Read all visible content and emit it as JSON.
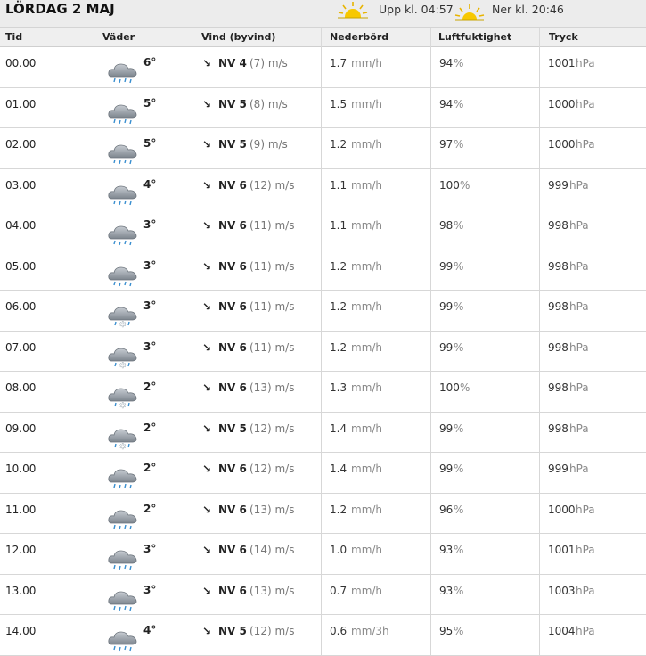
{
  "header": {
    "day": "LÖRDAG 2 MAJ",
    "sunrise_label": "Upp kl. 04:57",
    "sunset_label": "Ner kl. 20:46",
    "sun_icon_color": "#f2c400"
  },
  "columns": [
    "Tid",
    "Väder",
    "Vind (byvind)",
    "Nederbörd",
    "Luftfuktighet",
    "Tryck"
  ],
  "units": {
    "wind": "m/s",
    "pressure": "hPa",
    "humidity": "%"
  },
  "rows": [
    {
      "time": "00.00",
      "icon": "rain-cloud-icon",
      "temp": "6°",
      "arrow": "↘",
      "dir": "NV 4",
      "gust": "(7)",
      "precip": "1.7",
      "precip_unit": "mm/h",
      "humidity": "94",
      "pressure": "1001"
    },
    {
      "time": "01.00",
      "icon": "rain-cloud-icon",
      "temp": "5°",
      "arrow": "↘",
      "dir": "NV 5",
      "gust": "(8)",
      "precip": "1.5",
      "precip_unit": "mm/h",
      "humidity": "94",
      "pressure": "1000"
    },
    {
      "time": "02.00",
      "icon": "rain-cloud-icon",
      "temp": "5°",
      "arrow": "↘",
      "dir": "NV 5",
      "gust": "(9)",
      "precip": "1.2",
      "precip_unit": "mm/h",
      "humidity": "97",
      "pressure": "1000"
    },
    {
      "time": "03.00",
      "icon": "rain-cloud-icon",
      "temp": "4°",
      "arrow": "↘",
      "dir": "NV 6",
      "gust": "(12)",
      "precip": "1.1",
      "precip_unit": "mm/h",
      "humidity": "100",
      "pressure": "999"
    },
    {
      "time": "04.00",
      "icon": "rain-cloud-icon",
      "temp": "3°",
      "arrow": "↘",
      "dir": "NV 6",
      "gust": "(11)",
      "precip": "1.1",
      "precip_unit": "mm/h",
      "humidity": "98",
      "pressure": "998"
    },
    {
      "time": "05.00",
      "icon": "rain-cloud-icon",
      "temp": "3°",
      "arrow": "↘",
      "dir": "NV 6",
      "gust": "(11)",
      "precip": "1.2",
      "precip_unit": "mm/h",
      "humidity": "99",
      "pressure": "998"
    },
    {
      "time": "06.00",
      "icon": "sleet-cloud-icon",
      "temp": "3°",
      "arrow": "↘",
      "dir": "NV 6",
      "gust": "(11)",
      "precip": "1.2",
      "precip_unit": "mm/h",
      "humidity": "99",
      "pressure": "998"
    },
    {
      "time": "07.00",
      "icon": "sleet-cloud-icon",
      "temp": "3°",
      "arrow": "↘",
      "dir": "NV 6",
      "gust": "(11)",
      "precip": "1.2",
      "precip_unit": "mm/h",
      "humidity": "99",
      "pressure": "998"
    },
    {
      "time": "08.00",
      "icon": "sleet-cloud-icon",
      "temp": "2°",
      "arrow": "↘",
      "dir": "NV 6",
      "gust": "(13)",
      "precip": "1.3",
      "precip_unit": "mm/h",
      "humidity": "100",
      "pressure": "998"
    },
    {
      "time": "09.00",
      "icon": "sleet-cloud-icon",
      "temp": "2°",
      "arrow": "↘",
      "dir": "NV 5",
      "gust": "(12)",
      "precip": "1.4",
      "precip_unit": "mm/h",
      "humidity": "99",
      "pressure": "998"
    },
    {
      "time": "10.00",
      "icon": "rain-cloud-icon",
      "temp": "2°",
      "arrow": "↘",
      "dir": "NV 6",
      "gust": "(12)",
      "precip": "1.4",
      "precip_unit": "mm/h",
      "humidity": "99",
      "pressure": "999"
    },
    {
      "time": "11.00",
      "icon": "rain-cloud-icon",
      "temp": "2°",
      "arrow": "↘",
      "dir": "NV 6",
      "gust": "(13)",
      "precip": "1.2",
      "precip_unit": "mm/h",
      "humidity": "96",
      "pressure": "1000"
    },
    {
      "time": "12.00",
      "icon": "rain-cloud-icon",
      "temp": "3°",
      "arrow": "↘",
      "dir": "NV 6",
      "gust": "(14)",
      "precip": "1.0",
      "precip_unit": "mm/h",
      "humidity": "93",
      "pressure": "1001"
    },
    {
      "time": "13.00",
      "icon": "rain-cloud-icon",
      "temp": "3°",
      "arrow": "↘",
      "dir": "NV 6",
      "gust": "(13)",
      "precip": "0.7",
      "precip_unit": "mm/h",
      "humidity": "93",
      "pressure": "1003"
    },
    {
      "time": "14.00",
      "icon": "rain-cloud-icon",
      "temp": "4°",
      "arrow": "↘",
      "dir": "NV 5",
      "gust": "(12)",
      "precip": "0.6",
      "precip_unit": "mm/3h",
      "humidity": "95",
      "pressure": "1004"
    }
  ]
}
